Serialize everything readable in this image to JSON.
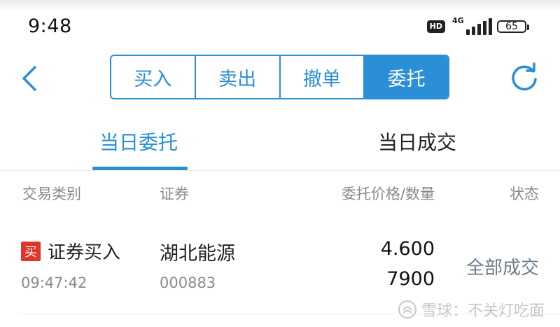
{
  "status_bar": {
    "time": "9:48",
    "hd_label": "HD",
    "network_label": "4G",
    "battery": "65"
  },
  "header": {
    "tabs": [
      {
        "label": "买入",
        "active": false
      },
      {
        "label": "卖出",
        "active": false
      },
      {
        "label": "撤单",
        "active": false
      },
      {
        "label": "委托",
        "active": true
      }
    ]
  },
  "subtabs": [
    {
      "label": "当日委托",
      "active": true
    },
    {
      "label": "当日成交",
      "active": false
    }
  ],
  "columns": [
    "交易类别",
    "证券",
    "委托价格/数量",
    "状态"
  ],
  "orders": [
    {
      "badge": "买",
      "type": "证券买入",
      "time": "09:47:42",
      "name": "湖北能源",
      "code": "000883",
      "price": "4.600",
      "quantity": "7900",
      "status": "全部成交"
    }
  ],
  "watermark": "雪球：不关灯吃面",
  "colors": {
    "accent": "#2a8fd6",
    "buy_badge": "#e0352b",
    "muted_text": "#8a8a8a"
  }
}
